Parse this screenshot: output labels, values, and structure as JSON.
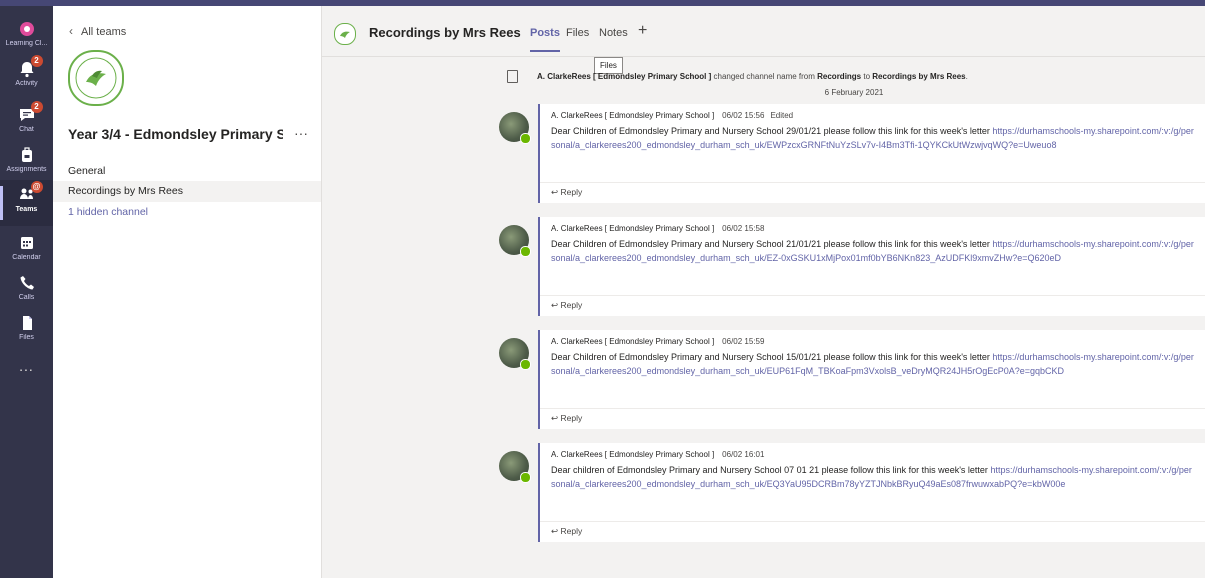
{
  "app": {
    "rail": [
      {
        "id": "learning",
        "label": "Learning Cl...",
        "icon": "learning-icon",
        "badge": ""
      },
      {
        "id": "activity",
        "label": "Activity",
        "icon": "bell-icon",
        "badge": "2"
      },
      {
        "id": "chat",
        "label": "Chat",
        "icon": "chat-icon",
        "badge": "2"
      },
      {
        "id": "assignments",
        "label": "Assignments",
        "icon": "backpack-icon",
        "badge": ""
      },
      {
        "id": "teams",
        "label": "Teams",
        "icon": "teams-icon",
        "badge": "@"
      },
      {
        "id": "calendar",
        "label": "Calendar",
        "icon": "calendar-icon",
        "badge": ""
      },
      {
        "id": "calls",
        "label": "Calls",
        "icon": "phone-icon",
        "badge": ""
      },
      {
        "id": "files",
        "label": "Files",
        "icon": "file-icon",
        "badge": ""
      }
    ],
    "more_label": "..."
  },
  "team": {
    "back_label": "All teams",
    "name": "Year 3/4 - Edmondsley Primary S...",
    "more_label": "···",
    "channels": [
      {
        "label": "General"
      },
      {
        "label": "Recordings by Mrs Rees"
      }
    ],
    "hidden_label": "1 hidden channel"
  },
  "channel": {
    "title": "Recordings by Mrs Rees",
    "tabs": [
      "Posts",
      "Files",
      "Notes"
    ],
    "add_tab": "+",
    "tooltip": "Files"
  },
  "system_message": {
    "actor": "A. ClarkeRees [ Edmondsley Primary School ]",
    "action": " changed channel name from ",
    "from": "Recordings",
    "to_word": " to ",
    "to": "Recordings by Mrs Rees",
    "end": ".",
    "date": "6 February 2021"
  },
  "posts": [
    {
      "author": "A. ClarkeRees [ Edmondsley Primary School ]",
      "time": "06/02 15:56",
      "edited": "Edited",
      "text": "Dear Children of Edmondsley Primary and Nursery School 29/01/21 please follow this link for this week's letter ",
      "link": "https://durhamschools-my.sharepoint.com/:v:/g/personal/a_clarkerees200_edmondsley_durham_sch_uk/EWPzcxGRNFtNuYzSLv7v-I4Bm3Tfi-1QYKCkUtWzwjvqWQ?e=Uweuo8",
      "reply": "Reply"
    },
    {
      "author": "A. ClarkeRees [ Edmondsley Primary School ]",
      "time": "06/02 15:58",
      "edited": "",
      "text": "Dear Children of Edmondsley Primary and Nursery School 21/01/21 please follow this link for this week's letter ",
      "link": "https://durhamschools-my.sharepoint.com/:v:/g/personal/a_clarkerees200_edmondsley_durham_sch_uk/EZ-0xGSKU1xMjPox01mf0bYB6NKn823_AzUDFKl9xmvZHw?e=Q620eD",
      "reply": "Reply"
    },
    {
      "author": "A. ClarkeRees [ Edmondsley Primary School ]",
      "time": "06/02 15:59",
      "edited": "",
      "text": "Dear Children of Edmondsley Primary and Nursery School 15/01/21 please follow this link for this week's letter ",
      "link": "https://durhamschools-my.sharepoint.com/:v:/g/personal/a_clarkerees200_edmondsley_durham_sch_uk/EUP61FqM_TBKoaFpm3VxolsB_veDryMQR24JH5rOgEcP0A?e=gqbCKD",
      "reply": "Reply"
    },
    {
      "author": "A. ClarkeRees [ Edmondsley Primary School ]",
      "time": "06/02 16:01",
      "edited": "",
      "text": "Dear children of Edmondsley Primary and Nursery School 07 01 21 please follow this link for this week's letter ",
      "link": "https://durhamschools-my.sharepoint.com/:v:/g/personal/a_clarkerees200_edmondsley_durham_sch_uk/EQ3YaU95DCRBm78yYZTJNbkBRyuQ49aEs087frwuwxabPQ?e=kbW00e",
      "reply": "Reply"
    }
  ],
  "colors": {
    "brand": "#6264a7",
    "rail": "#33344a",
    "badge": "#cc4a31",
    "online": "#6bb700"
  }
}
